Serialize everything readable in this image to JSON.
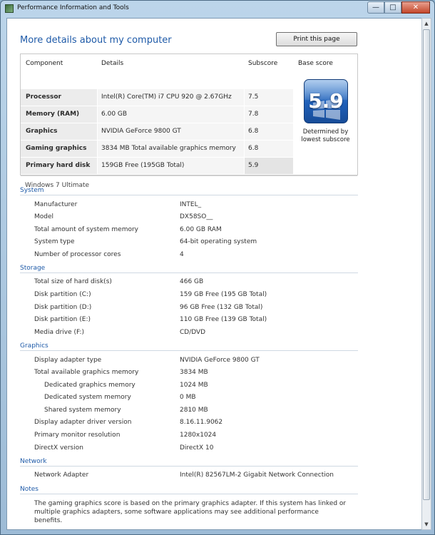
{
  "window": {
    "title": "Performance Information and Tools"
  },
  "page": {
    "heading": "More details about my computer",
    "print_label": "Print this page"
  },
  "score_table": {
    "headers": {
      "component": "Component",
      "details": "Details",
      "subscore": "Subscore",
      "base_score": "Base score"
    },
    "rows": [
      {
        "component": "Processor",
        "details": "Intel(R) Core(TM) i7 CPU 920 @ 2.67GHz",
        "subscore": "7.5"
      },
      {
        "component": "Memory (RAM)",
        "details": "6.00 GB",
        "subscore": "7.8"
      },
      {
        "component": "Graphics",
        "details": "NVIDIA GeForce 9800 GT",
        "subscore": "6.8"
      },
      {
        "component": "Gaming graphics",
        "details": "3834 MB Total available graphics memory",
        "subscore": "6.8"
      },
      {
        "component": "Primary hard disk",
        "details": "159GB Free (195GB Total)",
        "subscore": "5.9"
      }
    ],
    "base_score": "5.9",
    "base_caption_1": "Determined by",
    "base_caption_2": "lowest subscore",
    "edition": "Windows 7 Ultimate"
  },
  "sections": {
    "system": {
      "title": "System",
      "rows": [
        {
          "label": "Manufacturer",
          "value": "INTEL_"
        },
        {
          "label": "Model",
          "value": "DX58SO__"
        },
        {
          "label": "Total amount of system memory",
          "value": "6.00 GB RAM"
        },
        {
          "label": "System type",
          "value": "64-bit operating system"
        },
        {
          "label": "Number of processor cores",
          "value": "4"
        }
      ]
    },
    "storage": {
      "title": "Storage",
      "rows": [
        {
          "label": "Total size of hard disk(s)",
          "value": "466 GB"
        },
        {
          "label": "Disk partition (C:)",
          "value": "159 GB Free (195 GB Total)"
        },
        {
          "label": "Disk partition (D:)",
          "value": "96 GB Free (132 GB Total)"
        },
        {
          "label": "Disk partition (E:)",
          "value": "110 GB Free (139 GB Total)"
        },
        {
          "label": "Media drive (F:)",
          "value": "CD/DVD"
        }
      ]
    },
    "graphics": {
      "title": "Graphics",
      "rows": [
        {
          "label": "Display adapter type",
          "value": "NVIDIA GeForce 9800 GT"
        },
        {
          "label": "Total available graphics memory",
          "value": "3834 MB"
        },
        {
          "label": "Dedicated graphics memory",
          "value": "1024 MB"
        },
        {
          "label": "Dedicated system memory",
          "value": "0 MB"
        },
        {
          "label": "Shared system memory",
          "value": "2810 MB"
        },
        {
          "label": "Display adapter driver version",
          "value": "8.16.11.9062"
        },
        {
          "label": "Primary monitor resolution",
          "value": "1280x1024"
        },
        {
          "label": "DirectX version",
          "value": "DirectX 10"
        }
      ]
    },
    "network": {
      "title": "Network",
      "rows": [
        {
          "label": "Network Adapter",
          "value": "Intel(R) 82567LM-2 Gigabit Network Connection"
        }
      ]
    },
    "notes": {
      "title": "Notes",
      "text": "The gaming graphics score is based on the primary graphics adapter. If this system has linked or multiple graphics adapters, some software applications may see additional performance benefits."
    }
  }
}
